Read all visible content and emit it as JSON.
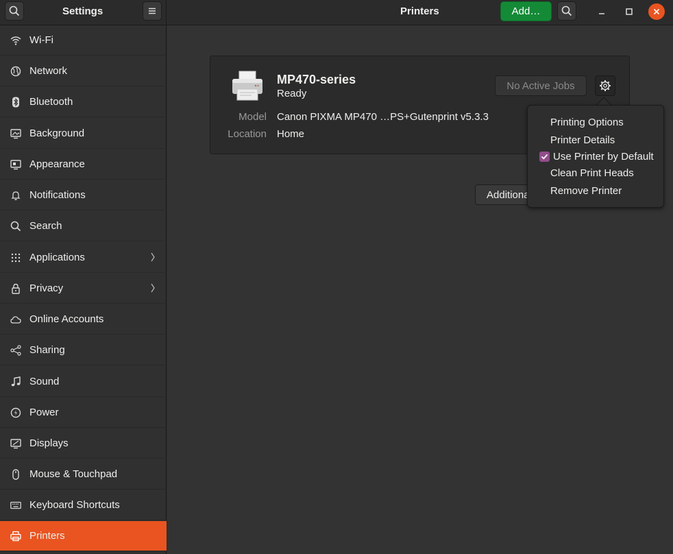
{
  "header": {
    "settings_title": "Settings",
    "page_title": "Printers",
    "add_label": "Add…"
  },
  "sidebar": {
    "items": [
      {
        "label": "Wi-Fi",
        "icon": "wifi-icon"
      },
      {
        "label": "Network",
        "icon": "network-icon"
      },
      {
        "label": "Bluetooth",
        "icon": "bluetooth-icon"
      },
      {
        "label": "Background",
        "icon": "background-icon"
      },
      {
        "label": "Appearance",
        "icon": "appearance-icon"
      },
      {
        "label": "Notifications",
        "icon": "bell-icon"
      },
      {
        "label": "Search",
        "icon": "search-icon"
      },
      {
        "label": "Applications",
        "icon": "grid-icon"
      },
      {
        "label": "Privacy",
        "icon": "lock-icon"
      },
      {
        "label": "Online Accounts",
        "icon": "cloud-icon"
      },
      {
        "label": "Sharing",
        "icon": "share-icon"
      },
      {
        "label": "Sound",
        "icon": "music-note-icon"
      },
      {
        "label": "Power",
        "icon": "power-icon"
      },
      {
        "label": "Displays",
        "icon": "display-icon"
      },
      {
        "label": "Mouse & Touchpad",
        "icon": "mouse-icon"
      },
      {
        "label": "Keyboard Shortcuts",
        "icon": "keyboard-icon"
      },
      {
        "label": "Printers",
        "icon": "printer-icon",
        "active": true
      }
    ]
  },
  "printer": {
    "name": "MP470-series",
    "status": "Ready",
    "model_label": "Model",
    "model_value": "Canon PIXMA MP470 …PS+Gutenprint v5.3.3",
    "location_label": "Location",
    "location_value": "Home",
    "jobs_label": "No Active Jobs"
  },
  "additional_label": "Additional Printer Settings…",
  "menu": {
    "items": [
      "Printing Options",
      "Printer Details",
      "Use Printer by Default",
      "Clean Print Heads",
      "Remove Printer"
    ],
    "default_checked": true
  },
  "colors": {
    "accent": "#e95420",
    "add_button": "#148a37",
    "checkbox": "#924d8b"
  }
}
